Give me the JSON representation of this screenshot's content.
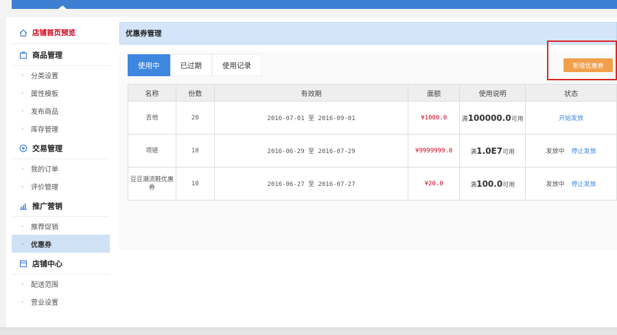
{
  "sidebar": {
    "home": "店铺首页预览",
    "groups": [
      {
        "title": "商品管理",
        "items": [
          "分类设置",
          "属性模板",
          "发布商品",
          "库存管理"
        ]
      },
      {
        "title": "交易管理",
        "items": [
          "我的订单",
          "评价管理"
        ]
      },
      {
        "title": "推广营销",
        "items": [
          "推荐促销",
          "优惠券"
        ]
      },
      {
        "title": "店铺中心",
        "items": [
          "配送范围",
          "营业设置"
        ]
      }
    ],
    "active_item": "优惠券"
  },
  "header": {
    "title": "优惠券管理"
  },
  "tabs": [
    "使用中",
    "已过期",
    "使用记录"
  ],
  "new_button": "新增优惠券",
  "table": {
    "columns": [
      "名称",
      "份数",
      "有效期",
      "面额",
      "使用说明",
      "状态"
    ],
    "rows": [
      {
        "name": "吉他",
        "count": "20",
        "period": "2016-07-01 至 2016-09-01",
        "amount": "¥1000.0",
        "usage_prefix": "满",
        "usage_value": "100000.0",
        "usage_suffix": "可用",
        "status": "",
        "action": "开始发放"
      },
      {
        "name": "项链",
        "count": "10",
        "period": "2016-06-29 至 2016-07-29",
        "amount": "¥9999999.0",
        "usage_prefix": "满",
        "usage_value": "1.0E7",
        "usage_suffix": "可用",
        "status": "发放中",
        "action": "停止发放"
      },
      {
        "name": "豆豆潮流鞋优惠券",
        "count": "10",
        "period": "2016-06-27 至 2016-07-27",
        "amount": "¥20.0",
        "usage_prefix": "满",
        "usage_value": "100.0",
        "usage_suffix": "可用",
        "status": "发放中",
        "action": "停止发放"
      }
    ]
  },
  "colors": {
    "accent": "#3d87e0",
    "danger": "#d0021b",
    "button": "#f0a04b",
    "highlight": "#e02020"
  }
}
